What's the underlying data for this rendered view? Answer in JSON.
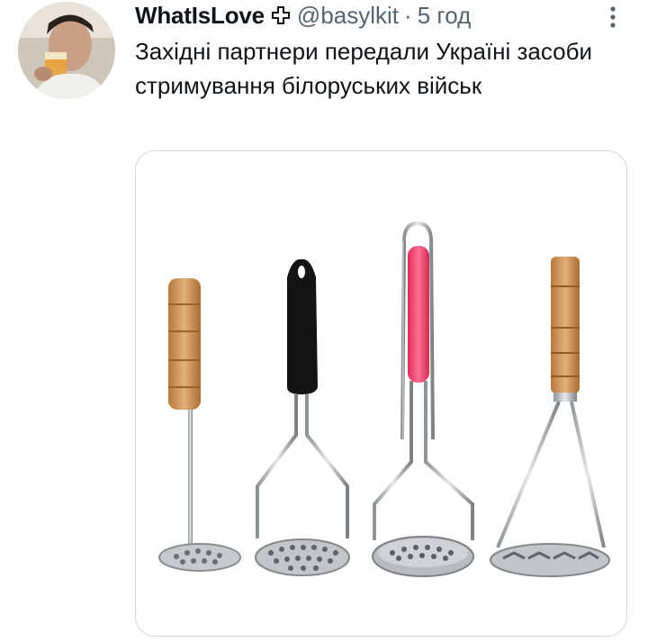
{
  "tweet": {
    "display_name": "WhatIsLove",
    "flag_icon": "swiss-cross-icon",
    "handle": "@basylkit",
    "separator": "·",
    "time": "5 год",
    "text": "Західні партнери передали Україні засоби стримування білоруських військ",
    "more_icon": "more-vertical-icon"
  },
  "media": {
    "description_icons": [
      "potato-masher-wooden-small",
      "potato-masher-black",
      "potato-masher-pink",
      "potato-masher-wooden-triangle"
    ]
  },
  "colors": {
    "text": "#0f1419",
    "secondary": "#536471",
    "border": "#cfd9de",
    "pink_handle": "#f0426a",
    "black_handle": "#111111",
    "wood": "#c98f4e"
  }
}
